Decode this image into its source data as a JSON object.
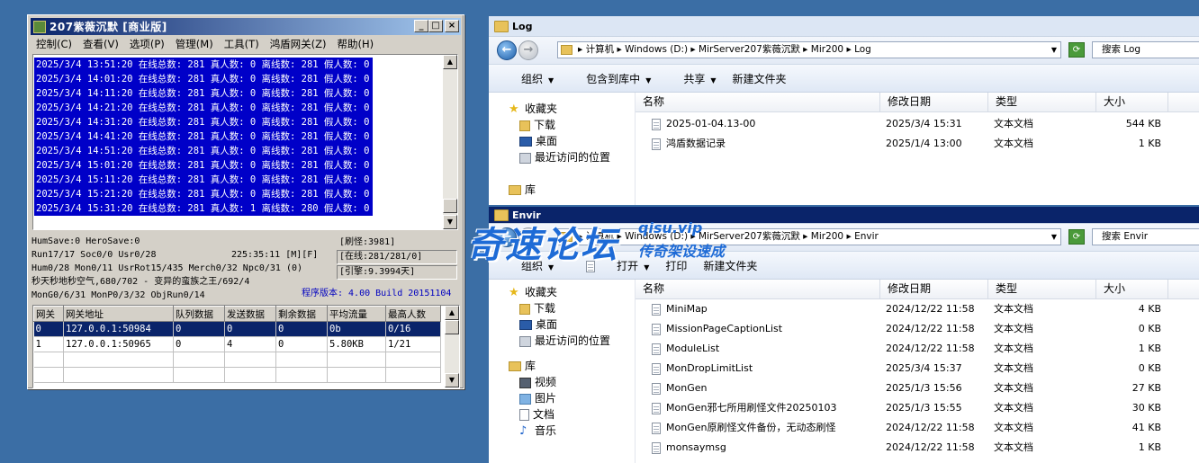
{
  "server": {
    "title": "207紫薇沉默 [商业版]",
    "menu": [
      "控制(C)",
      "查看(V)",
      "选项(P)",
      "管理(M)",
      "工具(T)",
      "鸿盾网关(Z)",
      "帮助(H)"
    ],
    "log_lines": [
      "2025/3/4 13:51:20 在线总数: 281 真人数: 0 离线数: 281 假人数: 0",
      "2025/3/4 14:01:20 在线总数: 281 真人数: 0 离线数: 281 假人数: 0",
      "2025/3/4 14:11:20 在线总数: 281 真人数: 0 离线数: 281 假人数: 0",
      "2025/3/4 14:21:20 在线总数: 281 真人数: 0 离线数: 281 假人数: 0",
      "2025/3/4 14:31:20 在线总数: 281 真人数: 0 离线数: 281 假人数: 0",
      "2025/3/4 14:41:20 在线总数: 281 真人数: 0 离线数: 281 假人数: 0",
      "2025/3/4 14:51:20 在线总数: 281 真人数: 0 离线数: 281 假人数: 0",
      "2025/3/4 15:01:20 在线总数: 281 真人数: 0 离线数: 281 假人数: 0",
      "2025/3/4 15:11:20 在线总数: 281 真人数: 0 离线数: 281 假人数: 0",
      "2025/3/4 15:21:20 在线总数: 281 真人数: 0 离线数: 281 假人数: 0",
      "2025/3/4 15:31:20 在线总数: 281 真人数: 1 离线数: 280 假人数: 0"
    ],
    "info": {
      "line1": "HumSave:0 HeroSave:0",
      "line2": "Run17/17 Soc0/0 Usr0/28",
      "uptime": "225:35:11 [M][F]",
      "line3": "Hum0/28 Mon0/11 UsrRot15/435 Merch0/32 Npc0/31 (0)",
      "line4": "秒天秒地秒空气,680/702 - 变异的蛮族之王/692/4",
      "line5": "MonG0/6/31 MonP0/3/32 ObjRun0/14",
      "refresh": "[刷怪:3981]",
      "online": "[在线:281/281/0]",
      "engine": "[引擎:9.3994天]",
      "version": "程序版本: 4.00 Build 20151104"
    },
    "grid": {
      "headers": [
        "网关",
        "网关地址",
        "队列数据",
        "发送数据",
        "剩余数据",
        "平均流量",
        "最高人数"
      ],
      "rows": [
        [
          "0",
          "127.0.0.1:50984",
          "0",
          "0",
          "0",
          "0b",
          "0/16"
        ],
        [
          "1",
          "127.0.0.1:50965",
          "0",
          "4",
          "0",
          "5.80KB",
          "1/21"
        ]
      ]
    }
  },
  "log_window": {
    "title": "Log",
    "path": [
      "计算机",
      "Windows (D:)",
      "MirServer207紫薇沉默",
      "Mir200",
      "Log"
    ],
    "search_placeholder": "搜索 Log",
    "commands": [
      "组织",
      "包含到库中",
      "共享",
      "新建文件夹"
    ],
    "nav": [
      "收藏夹",
      "下载",
      "桌面",
      "最近访问的位置",
      "库"
    ],
    "columns": [
      "名称",
      "修改日期",
      "类型",
      "大小"
    ],
    "files": [
      {
        "name": "2025-01-04.13-00",
        "date": "2025/3/4 15:31",
        "type": "文本文档",
        "size": "544 KB"
      },
      {
        "name": "鸿盾数据记录",
        "date": "2025/1/4 13:00",
        "type": "文本文档",
        "size": "1 KB"
      }
    ]
  },
  "envir_window": {
    "title": "Envir",
    "path": [
      "计算机",
      "Windows (D:)",
      "MirServer207紫薇沉默",
      "Mir200",
      "Envir"
    ],
    "search_placeholder": "搜索 Envir",
    "commands": [
      "组织",
      "打开",
      "打印",
      "新建文件夹"
    ],
    "nav": [
      "收藏夹",
      "下载",
      "桌面",
      "最近访问的位置",
      "库",
      "视频",
      "图片",
      "文档",
      "音乐"
    ],
    "columns": [
      "名称",
      "修改日期",
      "类型",
      "大小"
    ],
    "files": [
      {
        "name": "MiniMap",
        "date": "2024/12/22 11:58",
        "type": "文本文档",
        "size": "4 KB"
      },
      {
        "name": "MissionPageCaptionList",
        "date": "2024/12/22 11:58",
        "type": "文本文档",
        "size": "0 KB"
      },
      {
        "name": "ModuleList",
        "date": "2024/12/22 11:58",
        "type": "文本文档",
        "size": "1 KB"
      },
      {
        "name": "MonDropLimitList",
        "date": "2025/3/4 15:37",
        "type": "文本文档",
        "size": "0 KB"
      },
      {
        "name": "MonGen",
        "date": "2025/1/3 15:56",
        "type": "文本文档",
        "size": "27 KB"
      },
      {
        "name": "MonGen邪七所用刷怪文件20250103",
        "date": "2025/1/3 15:55",
        "type": "文本文档",
        "size": "30 KB"
      },
      {
        "name": "MonGen原刷怪文件备份，无动态刷怪",
        "date": "2024/12/22 11:58",
        "type": "文本文档",
        "size": "41 KB"
      },
      {
        "name": "monsaymsg",
        "date": "2024/12/22 11:58",
        "type": "文本文档",
        "size": "1 KB"
      }
    ]
  },
  "watermark": {
    "main": "奇速论坛",
    "url": "qisu.vip",
    "sub": "传奇架设速成"
  }
}
